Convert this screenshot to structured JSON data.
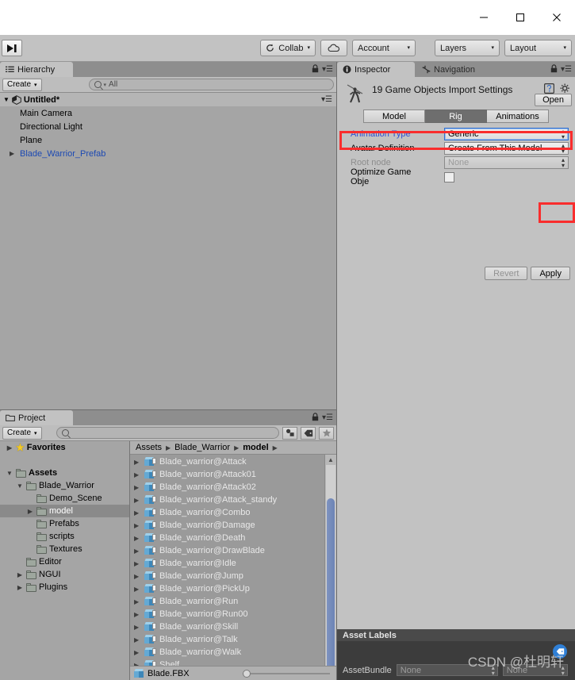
{
  "window": {
    "controls": [
      {
        "name": "minimize",
        "glyph": "—"
      },
      {
        "name": "maximize",
        "glyph": "□"
      },
      {
        "name": "close",
        "glyph": "✕"
      }
    ]
  },
  "toolbar": {
    "step_icon": "step-forward-icon",
    "collab": "Collab",
    "cloud_icon": "cloud-icon",
    "account": "Account",
    "layers": "Layers",
    "layout": "Layout",
    "caret": "▾"
  },
  "hierarchy": {
    "tab": "Hierarchy",
    "tab_icon": "hierarchy-icon",
    "create": "Create",
    "search_placeholder": "All",
    "scene_name": "Untitled*",
    "items": [
      {
        "label": "Main Camera",
        "expandable": false,
        "prefab": false
      },
      {
        "label": "Directional Light",
        "expandable": false,
        "prefab": false
      },
      {
        "label": "Plane",
        "expandable": false,
        "prefab": false
      },
      {
        "label": "Blade_Warrior_Prefab",
        "expandable": true,
        "prefab": true
      }
    ]
  },
  "project": {
    "tab": "Project",
    "create": "Create",
    "search_value": "",
    "filter_icons": [
      "type-filter-icon",
      "label-filter-icon",
      "favorite-star-icon"
    ],
    "tree": [
      {
        "label": "Favorites",
        "indent": 0,
        "twirl": "▶",
        "icon": "star",
        "bold": true,
        "selected": false
      },
      {
        "label": "",
        "indent": 0,
        "twirl": "",
        "icon": "none",
        "bold": false,
        "selected": false
      },
      {
        "label": "Assets",
        "indent": 0,
        "twirl": "▼",
        "icon": "folder",
        "bold": true,
        "selected": false
      },
      {
        "label": "Blade_Warrior",
        "indent": 1,
        "twirl": "▼",
        "icon": "folder",
        "bold": false,
        "selected": false
      },
      {
        "label": "Demo_Scene",
        "indent": 2,
        "twirl": "",
        "icon": "folder",
        "bold": false,
        "selected": false
      },
      {
        "label": "model",
        "indent": 2,
        "twirl": "▶",
        "icon": "folder",
        "bold": false,
        "selected": true
      },
      {
        "label": "Prefabs",
        "indent": 2,
        "twirl": "",
        "icon": "folder",
        "bold": false,
        "selected": false
      },
      {
        "label": "scripts",
        "indent": 2,
        "twirl": "",
        "icon": "folder",
        "bold": false,
        "selected": false
      },
      {
        "label": "Textures",
        "indent": 2,
        "twirl": "",
        "icon": "folder",
        "bold": false,
        "selected": false
      },
      {
        "label": "Editor",
        "indent": 1,
        "twirl": "",
        "icon": "folder",
        "bold": false,
        "selected": false
      },
      {
        "label": "NGUI",
        "indent": 1,
        "twirl": "▶",
        "icon": "folder",
        "bold": false,
        "selected": false
      },
      {
        "label": "Plugins",
        "indent": 1,
        "twirl": "▶",
        "icon": "folder",
        "bold": false,
        "selected": false
      }
    ],
    "breadcrumb": [
      "Assets",
      "Blade_Warrior",
      "model"
    ],
    "breadcrumb_sep": "▶",
    "files": [
      "Blade_warrior@Attack",
      "Blade_warrior@Attack01",
      "Blade_warrior@Attack02",
      "Blade_warrior@Attack_standy",
      "Blade_warrior@Combo",
      "Blade_warrior@Damage",
      "Blade_warrior@Death",
      "Blade_warrior@DrawBlade",
      "Blade_warrior@Idle",
      "Blade_warrior@Jump",
      "Blade_warrior@PickUp",
      "Blade_warrior@Run",
      "Blade_warrior@Run00",
      "Blade_warrior@Skill",
      "Blade_warrior@Talk",
      "Blade_warrior@Walk",
      "Shelf"
    ],
    "selected_file": "Blade.FBX"
  },
  "inspector": {
    "tabs": [
      {
        "label": "Inspector",
        "icon": "info-icon",
        "active": true
      },
      {
        "label": "Navigation",
        "icon": "navigation-icon",
        "active": false
      }
    ],
    "title": "19 Game Objects Import Settings",
    "thumbnail": "character-preview-icon",
    "help_icon": "help-book-icon",
    "gear_icon": "gear-icon",
    "open_button": "Open",
    "import_tabs": [
      {
        "label": "Model",
        "active": false
      },
      {
        "label": "Rig",
        "active": true
      },
      {
        "label": "Animations",
        "active": false
      }
    ],
    "fields": [
      {
        "label": "Animation Type",
        "value": "Generic",
        "kind": "popup",
        "highlight": true,
        "label_link": true,
        "disabled": false
      },
      {
        "label": "Avatar Definition",
        "value": "Create From This Model",
        "kind": "popup",
        "highlight": false,
        "label_link": false,
        "disabled": false
      },
      {
        "label": "Root node",
        "value": "None",
        "kind": "popup",
        "highlight": false,
        "label_link": false,
        "disabled": true
      },
      {
        "label": "Optimize Game Obje",
        "value": "",
        "kind": "checkbox",
        "highlight": false,
        "label_link": false,
        "disabled": false
      }
    ],
    "revert_button": "Revert",
    "apply_button": "Apply",
    "highlight_color": "#f92d2d"
  },
  "asset_labels": {
    "header": "Asset Labels",
    "bundle_label": "AssetBundle",
    "bundle_value": "None",
    "variant_value": "None",
    "tag_icon": "label-tag-icon"
  },
  "watermark": "CSDN @杜明轩"
}
